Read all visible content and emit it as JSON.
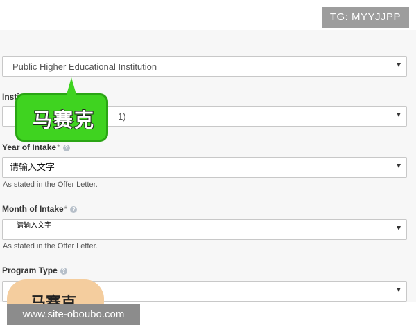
{
  "badge": {
    "tg_label": "TG: MYYJJPP"
  },
  "form": {
    "institution_type": {
      "value": "Public Higher Educational Institution"
    },
    "institution_name": {
      "label": "Institution Name",
      "required_marker": "*",
      "partial_value": "1)"
    },
    "year_of_intake": {
      "label": "Year of Intake",
      "required_marker": "*",
      "overlay_text": "请输入文字",
      "hint": "As stated in the Offer Letter."
    },
    "month_of_intake": {
      "label": "Month of Intake",
      "required_marker": "*",
      "overlay_text": "请输入文字",
      "hint": "As stated in the Offer Letter."
    },
    "program_type": {
      "label": "Program Type"
    }
  },
  "stickers": {
    "green_text": "马赛克",
    "peach_text": "马赛克"
  },
  "watermark": {
    "text": "www.site-oboubo.com"
  },
  "colors": {
    "page_bg": "#f7f7f7",
    "field_border": "#c8c8c8",
    "green_sticker": "#3fd320",
    "peach_sticker": "#f4cd9e",
    "watermark_bg": "#8c8c8c",
    "badge_bg": "#9d9d9d"
  },
  "icons": {
    "help": "question-circle-icon",
    "dropdown": "caret-down-icon"
  }
}
